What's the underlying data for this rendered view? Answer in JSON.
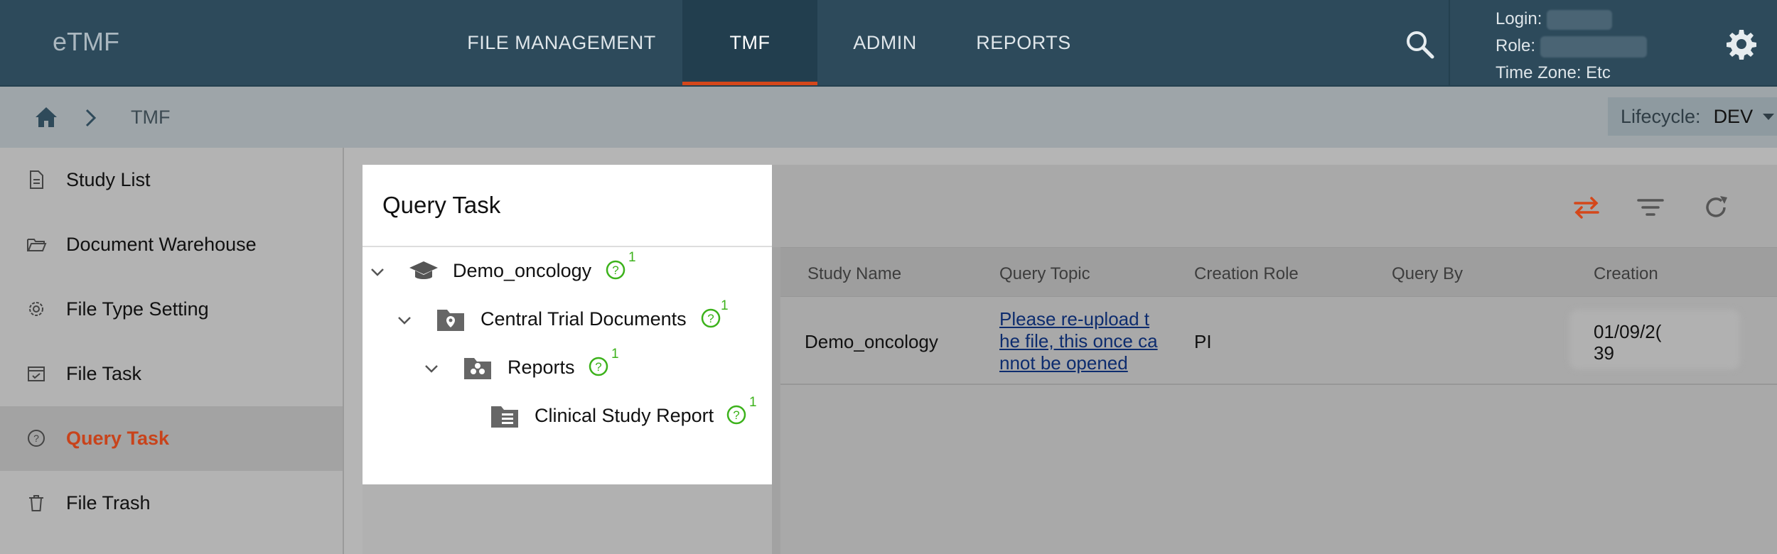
{
  "app": {
    "title": "eTMF"
  },
  "nav": {
    "items": [
      "FILE MANAGEMENT",
      "TMF",
      "ADMIN",
      "REPORTS"
    ],
    "active": "TMF"
  },
  "user": {
    "login_label": "Login:",
    "role_label": "Role:",
    "timezone_label": "Time Zone:",
    "timezone_value": "Etc"
  },
  "breadcrumb": {
    "current": "TMF"
  },
  "lifecycle": {
    "label": "Lifecycle:",
    "value": "DEV"
  },
  "sidebar": {
    "items": [
      {
        "label": "Study List",
        "icon": "document-icon"
      },
      {
        "label": "Document Warehouse",
        "icon": "folder-open-icon"
      },
      {
        "label": "File Type Setting",
        "icon": "gear-icon"
      },
      {
        "label": "File Task",
        "icon": "calendar-icon"
      },
      {
        "label": "Query Task",
        "icon": "question-circle-icon",
        "active": true
      },
      {
        "label": "File Trash",
        "icon": "trash-icon"
      }
    ]
  },
  "popup": {
    "title": "Query Task",
    "tree": [
      {
        "label": "Demo_oncology",
        "count": "1",
        "icon": "graduation-cap-icon"
      },
      {
        "label": "Central Trial Documents",
        "count": "1",
        "icon": "folder-location-icon"
      },
      {
        "label": "Reports",
        "count": "1",
        "icon": "folder-group-icon"
      },
      {
        "label": "Clinical Study Report",
        "count": "1",
        "icon": "folder-document-icon"
      }
    ]
  },
  "table": {
    "columns": [
      "Study Name",
      "Query Topic",
      "Creation Role",
      "Query By",
      "Creation"
    ],
    "rows": [
      {
        "study_name": "Demo_oncology",
        "query_topic_lines": [
          "Please re-upload t",
          "he file, this once ca",
          "nnot be opened"
        ],
        "creation_role": "PI",
        "creation_lines": [
          "01/09/2(",
          "39"
        ]
      }
    ]
  },
  "colors": {
    "accent": "#d4471a",
    "nav_bg": "#2d4a5b",
    "query_green": "#3cb21b"
  }
}
